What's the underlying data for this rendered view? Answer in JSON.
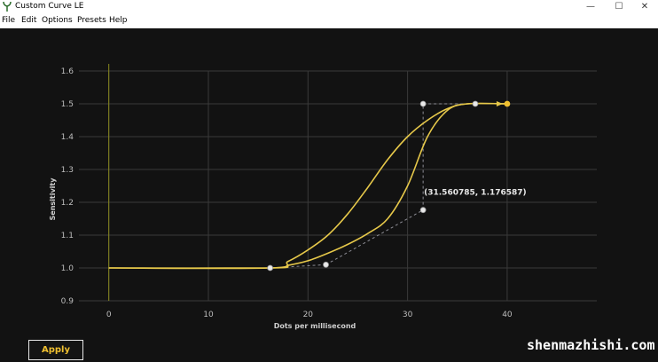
{
  "window": {
    "title": "Custom Curve LE",
    "controls": [
      "—",
      "☐",
      "✕"
    ]
  },
  "menu": [
    "File",
    "Edit",
    "Options",
    "Presets",
    "Help"
  ],
  "chart_data": {
    "type": "line",
    "xlabel": "Dots per millisecond",
    "ylabel": "Sensitivity",
    "xlim": [
      -3,
      49
    ],
    "ylim": [
      0.9,
      1.6
    ],
    "x_ticks": [
      0,
      10,
      20,
      30,
      40
    ],
    "y_ticks": [
      0.9,
      1.0,
      1.1,
      1.2,
      1.3,
      1.4,
      1.5,
      1.6
    ],
    "y_tick_labels": [
      "0.9",
      "1.0",
      "1.1",
      "1.2",
      "1.3",
      "1.4",
      "1.5",
      "1.6"
    ],
    "grid": true,
    "curve_color": "#e6c84a",
    "vertical_line_color": "#8a8a1e",
    "series": [
      {
        "x": [
          0,
          16.2,
          18,
          20,
          22,
          24,
          26,
          28,
          30,
          32,
          34,
          36,
          40
        ],
        "y": [
          1.0,
          1.0,
          1.02,
          1.055,
          1.1,
          1.165,
          1.245,
          1.33,
          1.4,
          1.45,
          1.485,
          1.5,
          1.5
        ]
      },
      {
        "x": [
          0,
          16.2,
          18,
          20,
          22,
          24,
          26,
          28,
          30,
          32,
          34,
          36,
          40
        ],
        "y": [
          1.0,
          1.0,
          1.008,
          1.022,
          1.045,
          1.072,
          1.105,
          1.15,
          1.25,
          1.4,
          1.48,
          1.5,
          1.5
        ]
      }
    ],
    "control_points": [
      {
        "x": 16.2,
        "y": 1.0
      },
      {
        "x": 21.8,
        "y": 1.01
      },
      {
        "x": 31.56,
        "y": 1.176587
      },
      {
        "x": 31.56,
        "y": 1.5
      },
      {
        "x": 36.8,
        "y": 1.5
      },
      {
        "x": 40,
        "y": 1.5
      }
    ],
    "dashed_links": [
      [
        {
          "x": 16.2,
          "y": 1.0
        },
        {
          "x": 21.8,
          "y": 1.01
        }
      ],
      [
        {
          "x": 21.8,
          "y": 1.01
        },
        {
          "x": 31.56,
          "y": 1.176587
        }
      ],
      [
        {
          "x": 31.56,
          "y": 1.176587
        },
        {
          "x": 31.56,
          "y": 1.5
        }
      ],
      [
        {
          "x": 31.56,
          "y": 1.5
        },
        {
          "x": 36.8,
          "y": 1.5
        }
      ]
    ],
    "annotation": {
      "text": "(31.560785, 1.176587)",
      "x": 31.56,
      "y": 1.176587
    }
  },
  "apply_label": "Apply",
  "watermark": "shenmazhishi.com"
}
